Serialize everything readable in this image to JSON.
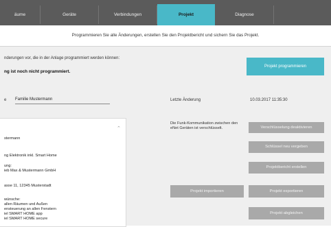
{
  "nav": {
    "tabs": [
      {
        "label": "äume",
        "active": false
      },
      {
        "label": "Geräte",
        "active": false
      },
      {
        "label": "Verbindungen",
        "active": false
      },
      {
        "label": "Projekt",
        "active": true
      },
      {
        "label": "Diagnose",
        "active": false
      }
    ]
  },
  "info_text": "Programmieren Sie alle Änderungen, erstellen Sie den Projektbericht und sichern Sie das Projekt.",
  "program": {
    "line1": "nderungen vor, die in der Anlage programmiert werden können:",
    "line2": "ng ist noch nicht programmiert.",
    "button": "Projekt programmieren"
  },
  "project": {
    "name_label": "e",
    "name_value": "Familie Mustermann",
    "last_change_label": "Letzte Änderung",
    "last_change_value": "10.03.2017 11:35:30"
  },
  "panel_lines": [
    "stermann",
    "ng Elektronik inkl. Smart Home",
    "ung:",
    "ieb Max & Mustermann GmbH",
    "asse 11, 12345 Musterstadt",
    "wünsche:",
    "  allen Räumen und Außen",
    "ensteuerung an allen Fenstern",
    "iel SMART HOME app",
    "iel SMART HOME secure"
  ],
  "funk_text": "Die Funk-Kommunikation zwischen den eNet Geräten ist verschlüsselt.",
  "buttons": {
    "disable_encryption": "Verschlüsselung deaktivieren",
    "assign_key": "Schlüssel neu vergeben",
    "create_report": "Projektbericht erstellen",
    "import_project": "Projekt importieren",
    "export_project": "Projekt exportieren",
    "sync_project": "Projekt abgleichen"
  },
  "colors": {
    "nav_bg": "#5b5b5b",
    "accent": "#49b8c8",
    "button_gray": "#a9a9a9",
    "panel_bg": "#efefef"
  },
  "icons": {
    "scroll_up": "chevron-up-icon"
  }
}
